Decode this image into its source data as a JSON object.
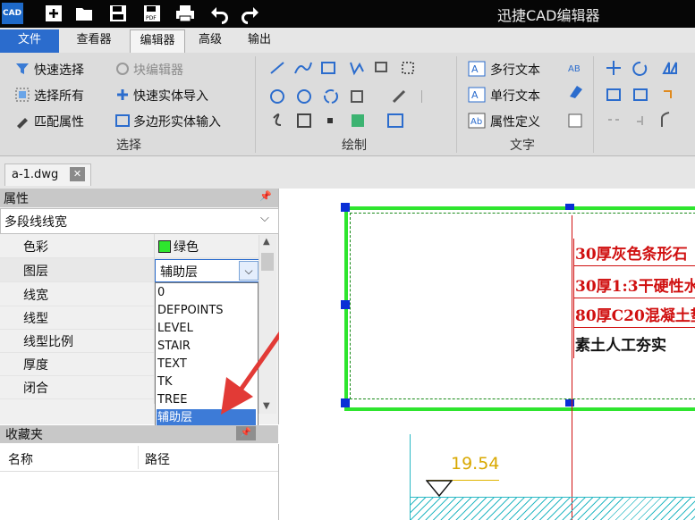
{
  "app": {
    "title": "迅捷CAD编辑器",
    "logo_text": "CAD"
  },
  "menu": {
    "tabs": [
      "文件",
      "查看器",
      "编辑器",
      "高级",
      "输出"
    ],
    "active": "编辑器"
  },
  "ribbon": {
    "groups": {
      "select": {
        "label": "选择",
        "items": [
          "快速选择",
          "块编辑器",
          "选择所有",
          "快速实体导入",
          "匹配属性",
          "多边形实体输入"
        ]
      },
      "draw": {
        "label": "绘制"
      },
      "text": {
        "label": "文字",
        "items": [
          "多行文本",
          "单行文本",
          "属性定义"
        ]
      }
    }
  },
  "document": {
    "tab": "a-1.dwg"
  },
  "properties": {
    "title": "属性",
    "entity_type": "多段线线宽",
    "rows": [
      {
        "label": "色彩",
        "value": "绿色"
      },
      {
        "label": "图层",
        "value": "辅助层"
      },
      {
        "label": "线宽",
        "value": ""
      },
      {
        "label": "线型",
        "value": ""
      },
      {
        "label": "线型比例",
        "value": ""
      },
      {
        "label": "厚度",
        "value": ""
      },
      {
        "label": "闭合",
        "value": ""
      }
    ],
    "layer_options": [
      "0",
      "DEFPOINTS",
      "LEVEL",
      "STAIR",
      "TEXT",
      "TK",
      "TREE",
      "辅助层"
    ],
    "selected_layer": "辅助层"
  },
  "favorites": {
    "title": "收藏夹",
    "columns": [
      "名称",
      "路径"
    ]
  },
  "drawing": {
    "notes": [
      "30厚灰色条形石",
      "30厚1:3干硬性水",
      "80厚C20混凝土垫",
      "素土人工夯实"
    ],
    "elevation": "19.54"
  },
  "colors": {
    "accent": "#2b6ccd",
    "selection_green": "#2ee52e",
    "note_red": "#d01010"
  }
}
